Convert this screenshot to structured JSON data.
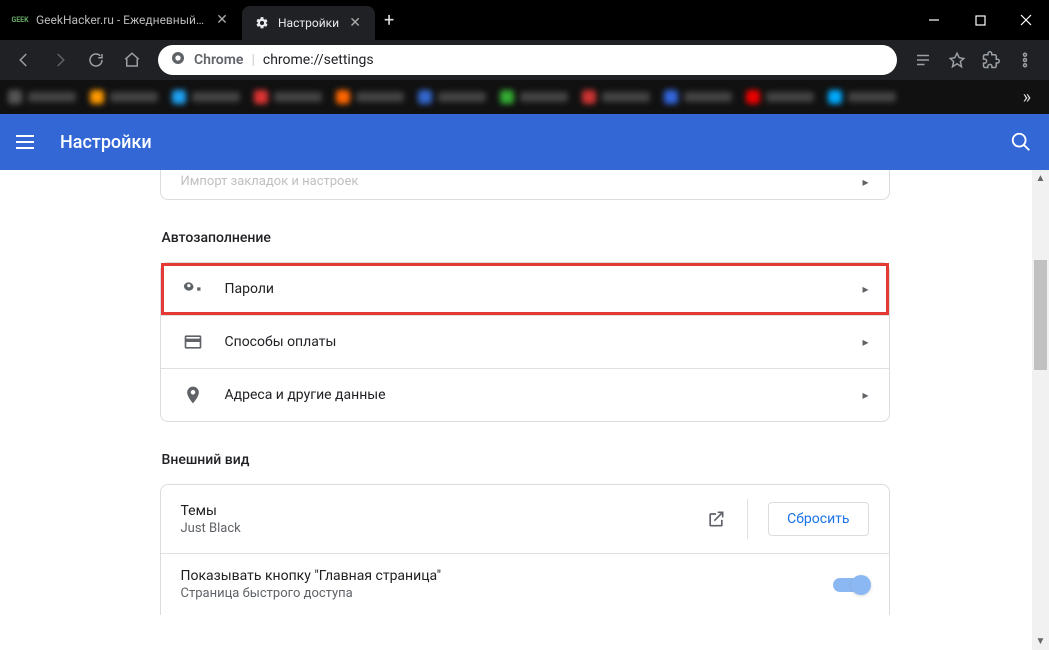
{
  "window": {
    "tabs": [
      {
        "label": "GeekHacker.ru - Ежедневный жу",
        "favicon_text": "GEEK"
      },
      {
        "label": "Настройки"
      }
    ],
    "controls": {
      "min": "—",
      "max": "□",
      "close": "✕"
    }
  },
  "toolbar": {
    "secure_label": "Chrome",
    "url": "chrome://settings"
  },
  "settings": {
    "title": "Настройки",
    "partial_top_row": "Импорт закладок и настроек",
    "sections": {
      "autofill": {
        "title": "Автозаполнение",
        "items": [
          {
            "label": "Пароли"
          },
          {
            "label": "Способы оплаты"
          },
          {
            "label": "Адреса и другие данные"
          }
        ]
      },
      "appearance": {
        "title": "Внешний вид",
        "theme": {
          "label": "Темы",
          "value": "Just Black",
          "reset": "Сбросить"
        },
        "home_button": {
          "label": "Показывать кнопку \"Главная страница\"",
          "sub": "Страница быстрого доступа"
        }
      }
    }
  }
}
